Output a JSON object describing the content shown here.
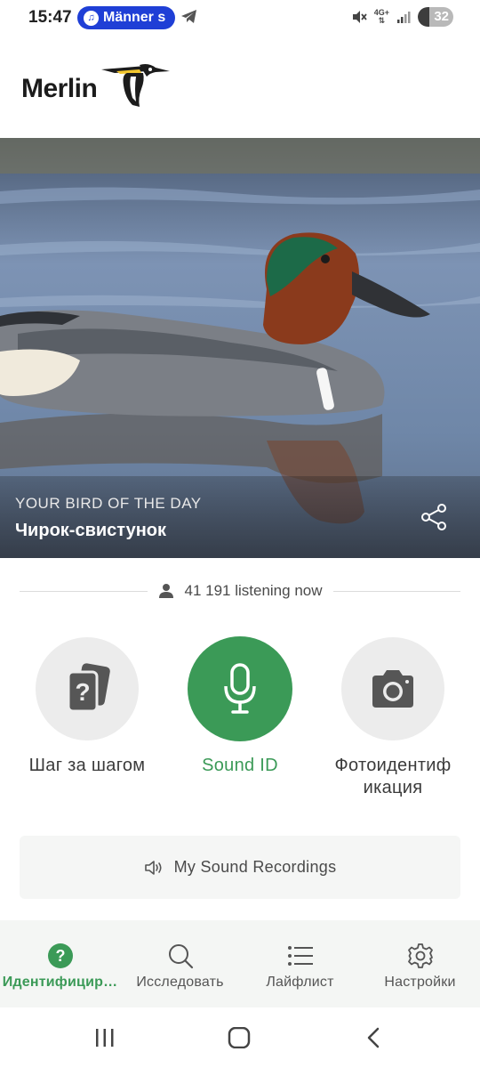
{
  "status_bar": {
    "time": "15:47",
    "media_pill": "Männer s",
    "network": "4G+",
    "battery": "32",
    "battery_level": 0.32
  },
  "logo": {
    "text": "Merlin"
  },
  "hero": {
    "kicker": "YOUR BIRD OF THE DAY",
    "bird_name": "Чирок-свистунок"
  },
  "listening": {
    "text": "41 191 listening now"
  },
  "actions": {
    "step_by_step": "Шаг за шагом",
    "sound_id": "Sound ID",
    "photo_id_line1": "Фотоидентиф",
    "photo_id_line2": "икация"
  },
  "recordings": {
    "label": "My Sound Recordings"
  },
  "bottom_nav": {
    "items": [
      {
        "label": "Идентифицир…",
        "icon": "question-circle-icon",
        "active": true
      },
      {
        "label": "Исследовать",
        "icon": "search-icon",
        "active": false
      },
      {
        "label": "Лайфлист",
        "icon": "list-icon",
        "active": false
      },
      {
        "label": "Настройки",
        "icon": "gear-icon",
        "active": false
      }
    ]
  },
  "colors": {
    "accent_green": "#3b9a57",
    "pill_blue": "#1f3fd6",
    "circle_gray": "#ececec"
  }
}
